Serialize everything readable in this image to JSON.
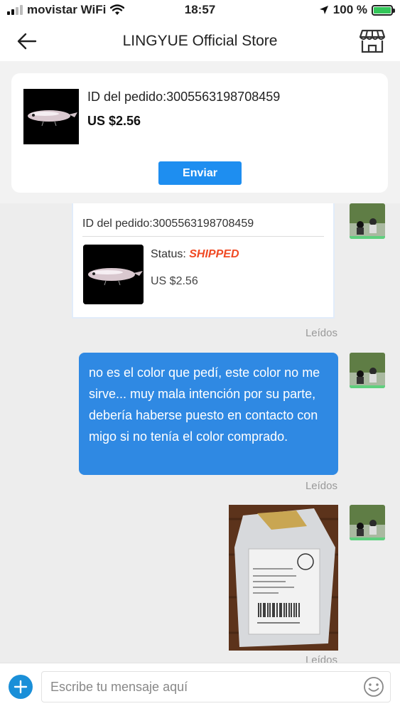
{
  "status_bar": {
    "carrier": "movistar WiFi",
    "time": "18:57",
    "battery": "100 %"
  },
  "header": {
    "title": "LINGYUE Official Store"
  },
  "order_card": {
    "order_id": "ID del pedido:3005563198708459",
    "price": "US $2.56",
    "send_label": "Enviar"
  },
  "chat": {
    "order_message": {
      "order_id": "ID del pedido:3005563198708459",
      "status_label": "Status: ",
      "status_value": "SHIPPED",
      "price": "US $2.56"
    },
    "read_label": "Leídos",
    "text_message": "no es el color que pedí, este color no me sirve... muy mala intención por su parte, debería haberse puesto en contacto con migo si no tenía el color comprado."
  },
  "input": {
    "placeholder": "Escribe tu mensaje aquí"
  },
  "colors": {
    "accent": "#1e8ef0",
    "bubble": "#2f89e3",
    "shipped": "#f04a24",
    "battery": "#33c659"
  }
}
